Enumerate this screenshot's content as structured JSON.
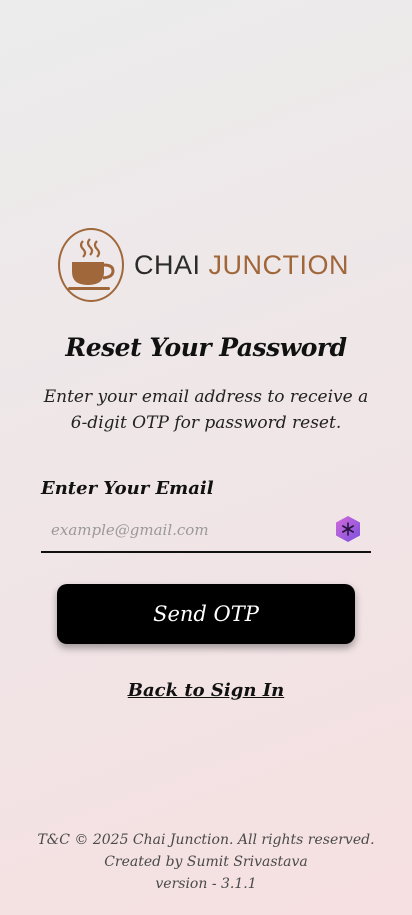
{
  "brand": {
    "name_part1": "CHAI",
    "name_part2": "JUNCTION",
    "colors": {
      "brown": "#a0673a",
      "dark": "#2b2b2b"
    }
  },
  "page": {
    "title": "Reset Your Password",
    "subtitle": "Enter your email address to receive a 6-digit OTP for password reset."
  },
  "form": {
    "email_label": "Enter Your Email",
    "email_placeholder": "example@gmail.com",
    "email_value": "",
    "submit_label": "Send OTP",
    "extension_icon": "password-manager-icon"
  },
  "links": {
    "back": "Back to Sign In"
  },
  "footer": {
    "copyright": "T&C © 2025 Chai Junction. All rights reserved.",
    "creator": "Created by Sumit Srivastava",
    "version": "version - 3.1.1"
  }
}
